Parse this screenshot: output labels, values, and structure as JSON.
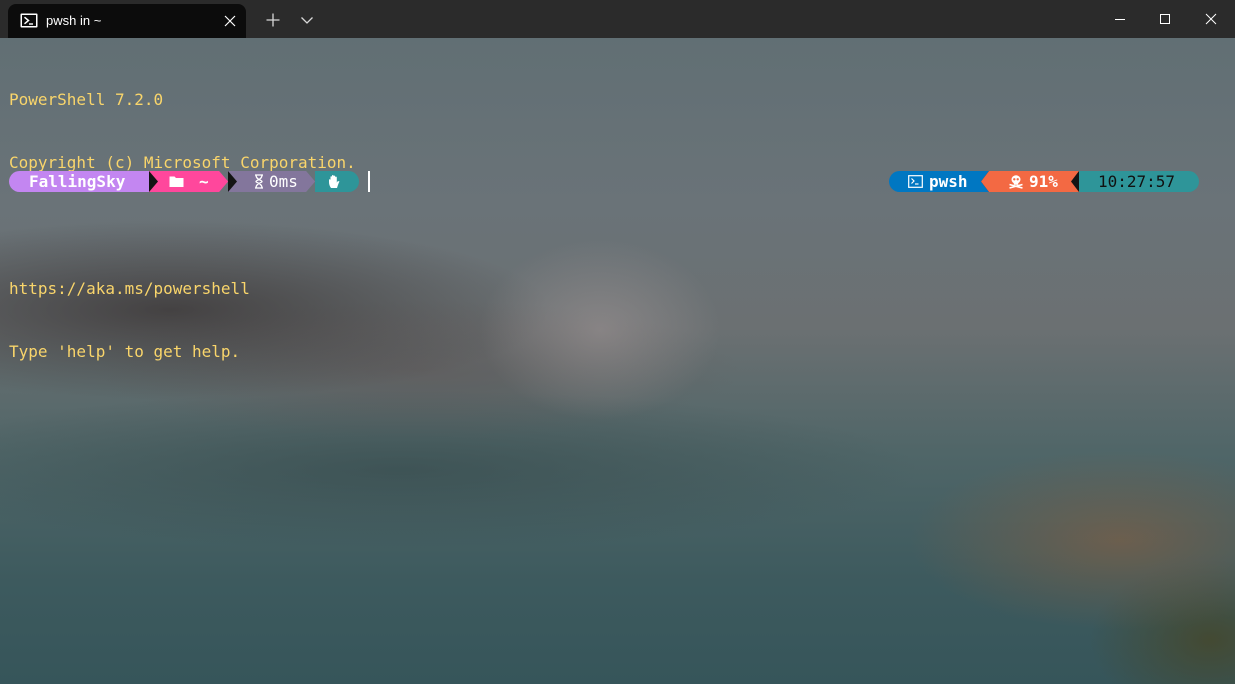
{
  "window": {
    "tab_title": "pwsh in ~"
  },
  "terminal": {
    "lines": [
      "PowerShell 7.2.0",
      "Copyright (c) Microsoft Corporation.",
      "",
      "https://aka.ms/powershell",
      "Type 'help' to get help."
    ]
  },
  "prompt": {
    "left": {
      "user": "FallingSky",
      "path": "~",
      "duration": "0ms"
    },
    "right": {
      "shell": "pwsh",
      "battery": "91%",
      "time": "10:27:57"
    }
  },
  "colors": {
    "titlebar": "#2b2b2b",
    "tab_background": "#0c0c0c",
    "terminal_text": "#f9d56b",
    "segment_user": "#c386f1",
    "segment_path": "#ff479c",
    "segment_duration": "#83769c",
    "segment_status": "#2e9599",
    "segment_shell": "#0077c2",
    "segment_battery": "#f36943",
    "segment_time": "#2e9599",
    "separator_dark": "#141414"
  },
  "icons": {
    "tab_icon": "powershell-icon",
    "tab_close": "close-icon",
    "new_tab": "plus-icon",
    "tab_dropdown": "chevron-down-icon",
    "minimize": "minimize-icon",
    "maximize": "maximize-icon",
    "close_window": "close-icon",
    "path": "folder-icon",
    "duration": "hourglass-icon",
    "status": "hand-icon",
    "shell": "terminal-icon",
    "battery": "skull-icon"
  }
}
